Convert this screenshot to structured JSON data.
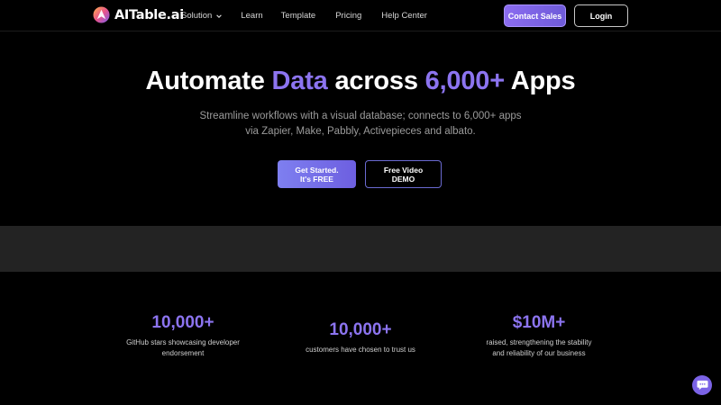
{
  "brand": {
    "name": "AITable.ai"
  },
  "nav": {
    "items": [
      {
        "label": "Solution",
        "has_dropdown": true
      },
      {
        "label": "Learn"
      },
      {
        "label": "Template"
      },
      {
        "label": "Pricing"
      },
      {
        "label": "Help Center"
      }
    ],
    "contact_label": "Contact Sales",
    "login_label": "Login"
  },
  "hero": {
    "title_part1": "Automate ",
    "title_accent1": "Data",
    "title_part2": " across ",
    "title_accent2": "6,000+",
    "title_part3": " Apps",
    "subtitle_line1": "Streamline workflows with a visual database; connects to 6,000+ apps",
    "subtitle_line2": "via Zapier, Make, Pabbly, Activepieces and albato.",
    "cta_primary_line1": "Get Started.",
    "cta_primary_line2": "It's FREE",
    "cta_secondary_line1": "Free Video",
    "cta_secondary_line2": "DEMO"
  },
  "stats": [
    {
      "value": "10,000+",
      "desc_line1": "GitHub stars showcasing developer",
      "desc_line2": "endorsement"
    },
    {
      "value": "10,000+",
      "desc_line1": "customers have chosen to trust us",
      "desc_line2": ""
    },
    {
      "value": "$10M+",
      "desc_line1": "raised, strengthening the stability",
      "desc_line2": "and reliability of our business"
    }
  ],
  "chat": {
    "icon": "chat-bubble-icon"
  },
  "colors": {
    "accent": "#8c74f0",
    "background": "#000000",
    "band": "#232323"
  }
}
